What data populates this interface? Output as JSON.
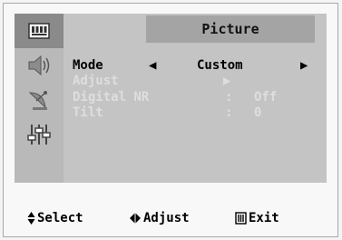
{
  "header": {
    "title": "Picture"
  },
  "sidebar": {
    "items": [
      {
        "icon": "picture-menu-icon"
      },
      {
        "icon": "sound-speaker-icon"
      },
      {
        "icon": "channel-antenna-icon"
      },
      {
        "icon": "setup-sliders-icon"
      },
      {
        "icon": "empty-slot"
      }
    ]
  },
  "menu": {
    "mode": {
      "label": "Mode",
      "value": "Custom",
      "left_arrow": "◀",
      "right_arrow": "▶"
    },
    "adjust": {
      "label": "Adjust",
      "arrow": "▶"
    },
    "digital_nr": {
      "label": "Digital NR",
      "colon": ":",
      "value": "Off"
    },
    "tilt": {
      "label": "Tilt",
      "colon": ":",
      "value": "0"
    }
  },
  "footer": {
    "select_label": "Select",
    "adjust_label": "Adjust",
    "exit_label": "Exit"
  }
}
